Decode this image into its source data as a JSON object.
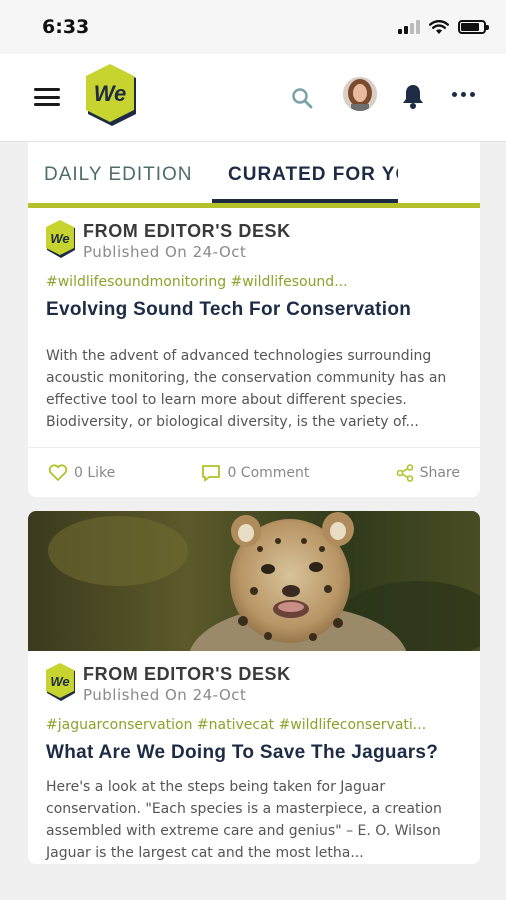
{
  "status_bar": {
    "time": "6:33"
  },
  "header": {
    "logo_text": "We"
  },
  "tabs": [
    {
      "label": "DAILY EDITION"
    },
    {
      "label": "CURATED FOR YOU"
    }
  ],
  "posts": [
    {
      "source": "FROM EDITOR'S DESK",
      "published": "Published On 24-Oct",
      "tags": "#wildlifesoundmonitoring #wildlifesound...",
      "title": "Evolving Sound Tech For Conservation",
      "excerpt": "With the advent of advanced technologies surrounding acoustic monitoring, the conservation community has an effective tool to learn more about different species. Biodiversity, or biological diversity, is the variety of...",
      "like_label": "0 Like",
      "comment_label": "0 Comment",
      "share_label": "Share"
    },
    {
      "source": "FROM EDITOR'S DESK",
      "published": "Published On 24-Oct",
      "tags": "#jaguarconservation #nativecat #wildlifeconservati...",
      "title": "What Are We Doing To Save The Jaguars?",
      "excerpt": "Here's a look at the steps being taken for Jaguar conservation. \"Each species is a masterpiece, a creation assembled with extreme care and genius\" – E. O. Wilson Jaguar is the largest cat and the most letha..."
    }
  ],
  "colors": {
    "brand_yellow": "#c7d42f",
    "brand_navy": "#1d2b44",
    "tag_green": "#8fa12a"
  }
}
